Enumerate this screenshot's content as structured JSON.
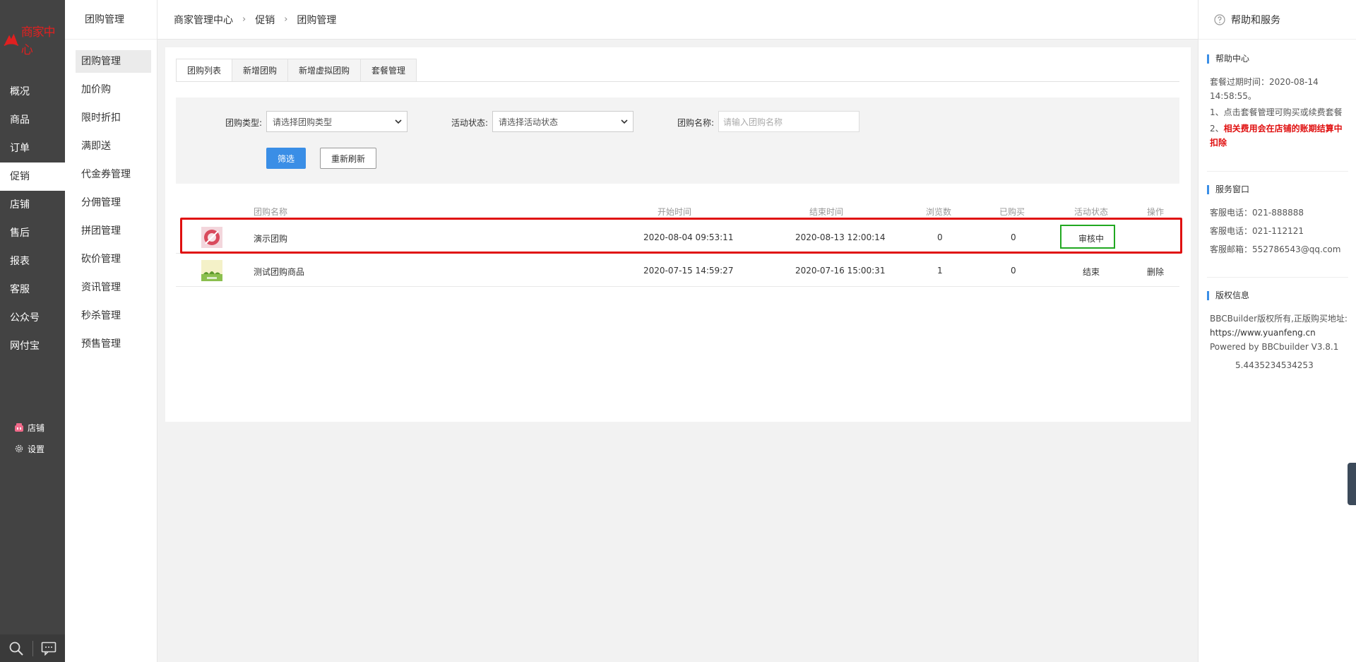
{
  "brand": {
    "logo_text": "商家中心",
    "accent": "#e02020"
  },
  "main_nav": [
    {
      "label": "概况",
      "active": false
    },
    {
      "label": "商品",
      "active": false
    },
    {
      "label": "订单",
      "active": false
    },
    {
      "label": "促销",
      "active": true
    },
    {
      "label": "店铺",
      "active": false
    },
    {
      "label": "售后",
      "active": false
    },
    {
      "label": "报表",
      "active": false
    },
    {
      "label": "客服",
      "active": false
    },
    {
      "label": "公众号",
      "active": false
    },
    {
      "label": "网付宝",
      "active": false
    }
  ],
  "bottom_links": {
    "shop": "店铺",
    "settings": "设置"
  },
  "footer_icons": [
    "search-icon",
    "chat-icon"
  ],
  "sub_nav": {
    "title": "团购管理",
    "items": [
      {
        "label": "团购管理",
        "active": true
      },
      {
        "label": "加价购",
        "active": false
      },
      {
        "label": "限时折扣",
        "active": false
      },
      {
        "label": "满即送",
        "active": false
      },
      {
        "label": "代金券管理",
        "active": false
      },
      {
        "label": "分佣管理",
        "active": false
      },
      {
        "label": "拼团管理",
        "active": false
      },
      {
        "label": "砍价管理",
        "active": false
      },
      {
        "label": "资讯管理",
        "active": false
      },
      {
        "label": "秒杀管理",
        "active": false
      },
      {
        "label": "预售管理",
        "active": false
      }
    ]
  },
  "breadcrumb": [
    "商家管理中心",
    "促销",
    "团购管理"
  ],
  "tabs": [
    {
      "label": "团购列表",
      "active": true
    },
    {
      "label": "新增团购",
      "active": false
    },
    {
      "label": "新增虚拟团购",
      "active": false
    },
    {
      "label": "套餐管理",
      "active": false
    }
  ],
  "filter": {
    "type_label": "团购类型:",
    "type_placeholder": "请选择团购类型",
    "status_label": "活动状态:",
    "status_placeholder": "请选择活动状态",
    "name_label": "团购名称:",
    "name_placeholder": "请输入团购名称",
    "filter_button": "筛选",
    "refresh_button": "重新刷新",
    "primary_color": "#3a8ee6"
  },
  "table": {
    "headers": {
      "name": "团购名称",
      "start": "开始时间",
      "end": "结束时间",
      "views": "浏览数",
      "bought": "已购买",
      "status": "活动状态",
      "action": "操作"
    },
    "rows": [
      {
        "name": "演示团购",
        "start": "2020-08-04 09:53:11",
        "end": "2020-08-13 12:00:14",
        "views": "0",
        "bought": "0",
        "status": "审核中",
        "action": ""
      },
      {
        "name": "测试团购商品",
        "start": "2020-07-15 14:59:27",
        "end": "2020-07-16 15:00:31",
        "views": "1",
        "bought": "0",
        "status": "结束",
        "action": "删除"
      }
    ],
    "highlight_row_color": "#e01010",
    "highlight_status_color": "#21a821"
  },
  "help": {
    "title": "帮助和服务",
    "help_center_title": "帮助中心",
    "expire_line1": "套餐过期时间：2020-08-14",
    "expire_line2": "14:58:55。",
    "tip1": "1、点击套餐管理可购买或续费套餐",
    "tip2_prefix": "2、",
    "tip2_red1": "相关费用会在店铺的账期结算中",
    "tip2_red2": "扣除",
    "service_title": "服务窗口",
    "phone1": "客服电话：021-888888",
    "phone2": "客服电话：021-112121",
    "email": "客服邮箱：552786543@qq.com",
    "copyright_title": "版权信息",
    "copyright1": "BBCBuilder版权所有,正版购买地址:",
    "copyright2": "https://www.yuanfeng.cn",
    "powered": "Powered by BBCbuilder V3.8.1",
    "version": "5.4435234534253"
  }
}
